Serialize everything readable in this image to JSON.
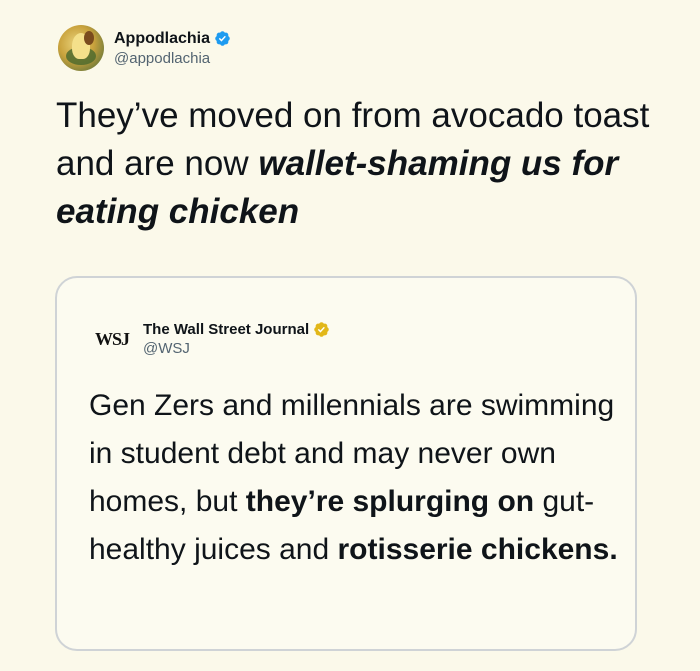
{
  "tweet": {
    "author": {
      "name": "Appodlachia",
      "handle": "@appodlachia",
      "verified": true,
      "verified_color": "#1d9bf0"
    },
    "text_part1": "They’ve moved on from avocado toast and are now ",
    "text_emphasis": "wallet-shaming us for eating chicken"
  },
  "quoted_tweet": {
    "author": {
      "name": "The Wall Street Journal",
      "handle": "@WSJ",
      "logo_text": "WSJ",
      "verified": true,
      "verified_color": "#e2b719"
    },
    "text_part1": "Gen Zers and millennials are swimming in student debt and may never own homes, but ",
    "text_bold1": "they’re splurging on",
    "text_part2": " gut-healthy juices and ",
    "text_bold2": "rotisserie chickens."
  },
  "colors": {
    "background": "#fbf9ea",
    "text": "#0f1419",
    "secondary_text": "#536471",
    "card_border": "#cfd3d6"
  }
}
